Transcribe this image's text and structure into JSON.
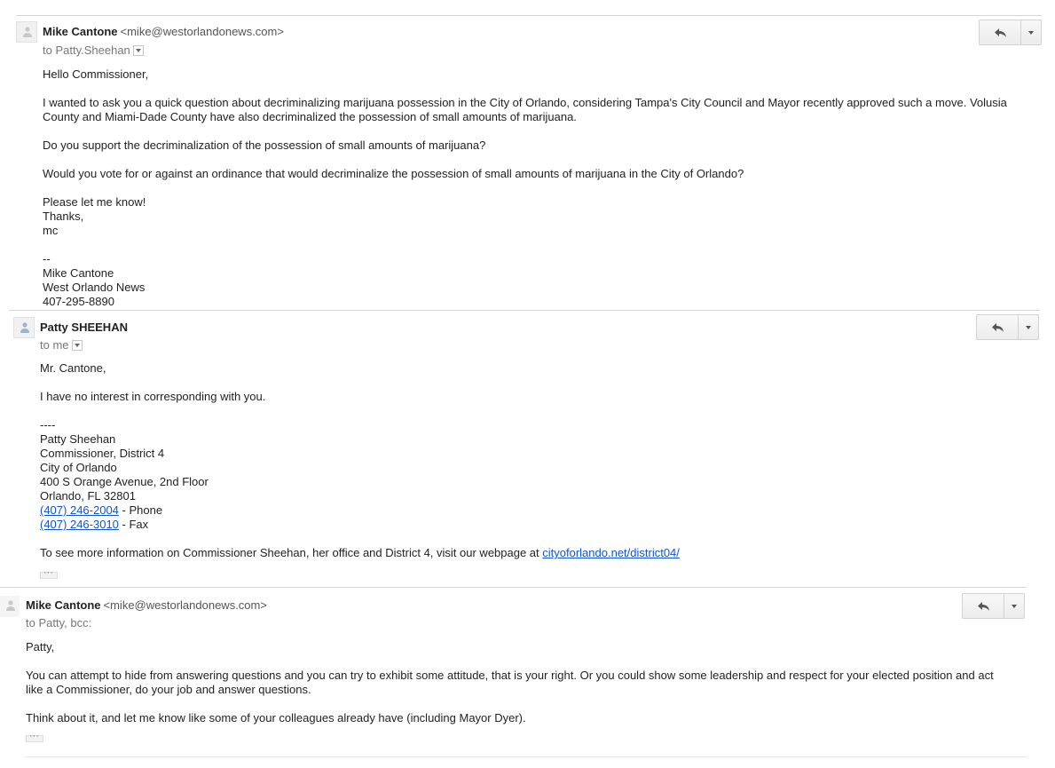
{
  "messages": [
    {
      "sender_name": "Mike Cantone",
      "sender_email": "<mike@westorlandonews.com>",
      "recipients": "to Patty.Sheehan",
      "icons": {
        "avatar": "person-icon",
        "reply": "reply-icon",
        "more": "chevron-down-icon"
      },
      "lines": [
        "Hello Commissioner,",
        "",
        "I wanted to ask you a quick question about decriminalizing marijuana possession in the City of Orlando, considering Tampa's City Council and Mayor recently approved such a move. Volusia County and Miami-Dade County have also decriminalized the possession of small amounts of marijuana.",
        "",
        "Do you support the decriminalization of the possession of small amounts of marijuana?",
        "",
        "Would you vote for or against an ordinance that would decriminalize the possession of small amounts of marijuana in the City of Orlando?",
        "",
        "Please let me know!",
        "Thanks,",
        "mc",
        "",
        "--",
        "Mike Cantone",
        "West Orlando News",
        "407-295-8890"
      ]
    },
    {
      "sender_name": "Patty SHEEHAN",
      "recipients": "to me",
      "greeting": "Mr. Cantone,",
      "text": "I have no interest in corresponding with you.",
      "sig_sep": "----",
      "sig_name": "Patty Sheehan",
      "sig_title": "Commissioner, District 4",
      "sig_org": "City of Orlando",
      "sig_addr1": "400 S Orange Avenue, 2nd Floor",
      "sig_addr2": "Orlando, FL  32801",
      "phone": "(407) 246-2004",
      "phone_label": " - Phone",
      "fax": "(407) 246-3010",
      "fax_label": " - Fax",
      "info_text": "To see more information on Commissioner Sheehan, her office and District 4, visit our webpage at ",
      "info_link": "cityoforlando.net/district04/"
    },
    {
      "sender_name": "Mike Cantone",
      "sender_email": "<mike@westorlandonews.com>",
      "recipients": "to Patty, bcc:",
      "greeting": "Patty,",
      "para1": "You can attempt to hide from answering questions and you can try to exhibit some attitude, that is your right. Or you could show some leadership and respect for your elected position and act like a Commissioner, do your job and answer questions.",
      "para2": "Think about it, and let me know like some of your colleagues already have (including Mayor Dyer)."
    }
  ]
}
